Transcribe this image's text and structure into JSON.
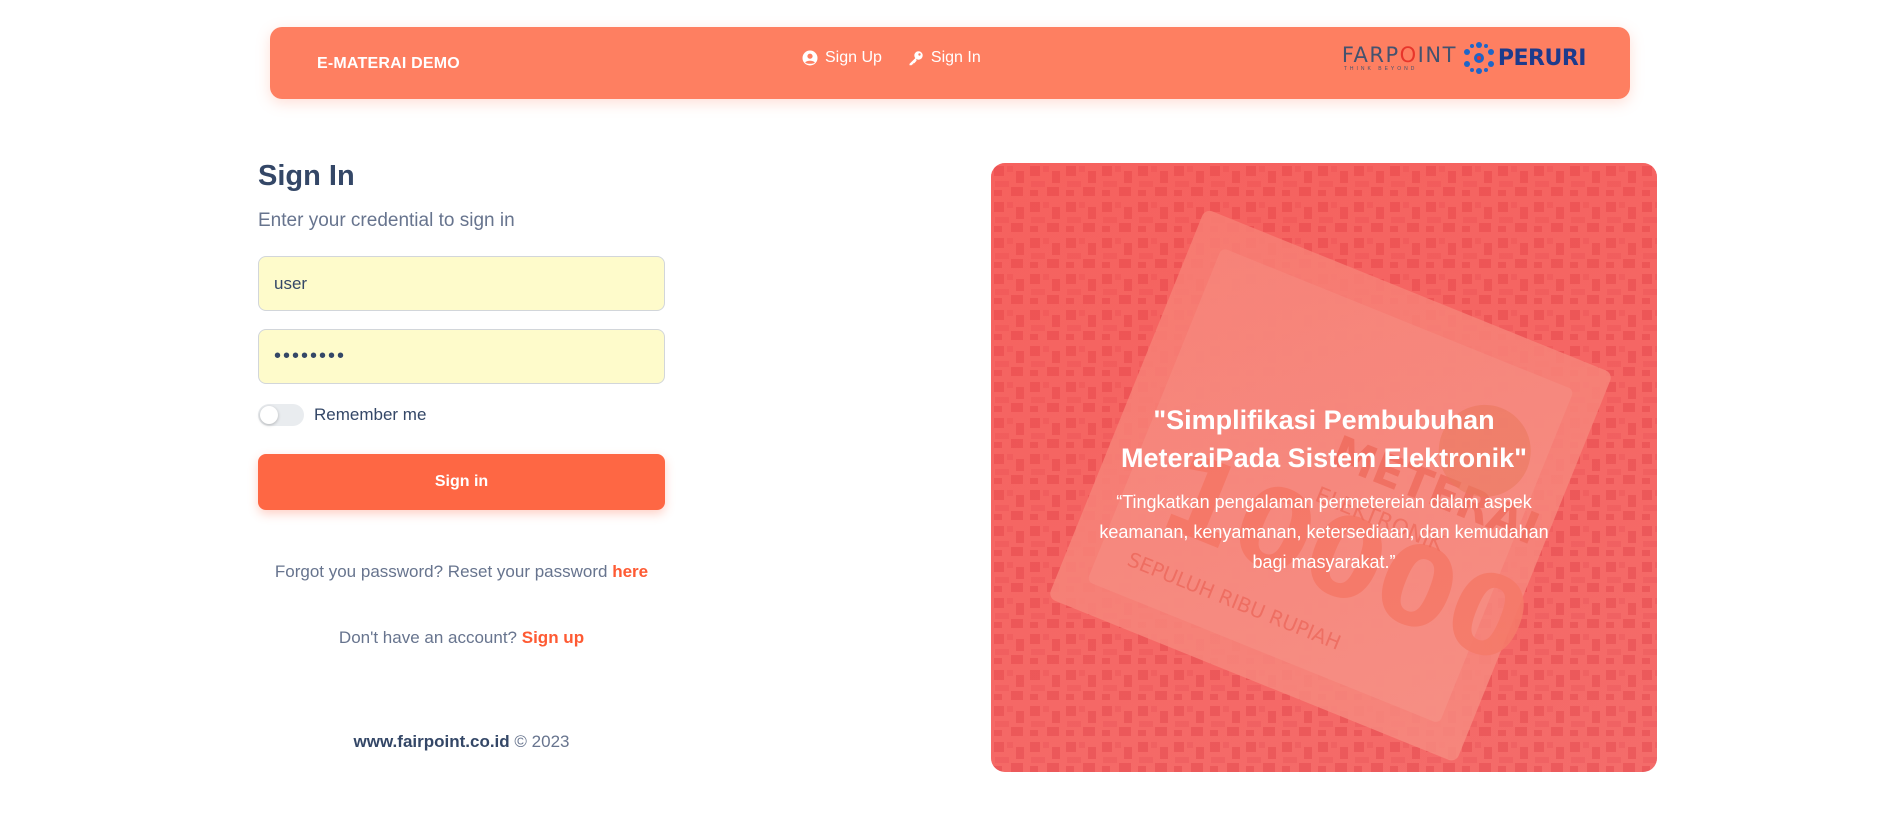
{
  "navbar": {
    "brand": "E-MATERAI DEMO",
    "links": [
      {
        "label": "Sign Up",
        "icon": "user-circle-icon"
      },
      {
        "label": "Sign In",
        "icon": "key-icon"
      }
    ],
    "logos": {
      "farpoint": "FARPOINT",
      "farpoint_tagline": "THINK BEYOND",
      "peruri": "PERURI"
    }
  },
  "form": {
    "title": "Sign In",
    "subtitle": "Enter your credential to sign in",
    "username_value": "user",
    "password_value": "password",
    "remember_label": "Remember me",
    "remember_checked": false,
    "signin_label": "Sign in"
  },
  "links": {
    "forgot_text": "Forgot you password? Reset your password ",
    "forgot_link": "here",
    "signup_text": "Don't have an account? ",
    "signup_link": "Sign up"
  },
  "footer": {
    "domain": "www.fairpoint.co.id",
    "copyright": "© 2023"
  },
  "hero": {
    "quote": "\"Simplifikasi Pembubuhan MeteraiPada Sistem Elektronik\"",
    "subtext": "“Tingkatkan pengalaman permetereian dalam aspek keamanan, kenyamanan, ketersediaan, dan kemudahan bagi masyarakat.”"
  },
  "colors": {
    "navbar": "#fe7f61",
    "primary_button": "#fe6744",
    "link_accent": "#fe5a33",
    "input_autofill": "#fefbcb",
    "heading": "#344767"
  }
}
